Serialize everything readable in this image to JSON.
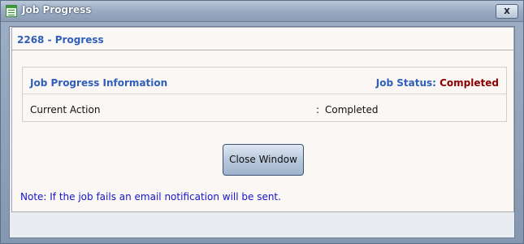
{
  "window": {
    "title": "Job Progress",
    "close_label": "x"
  },
  "panel": {
    "title": "2268 - Progress"
  },
  "info": {
    "title": "Job Progress Information",
    "status_label": "Job Status:",
    "status_value": "Completed",
    "row_label": "Current Action",
    "row_colon": ":",
    "row_value": "Completed"
  },
  "actions": {
    "close_window_label": "Close Window"
  },
  "note": "Note: If the job fails an email notification will be sent.",
  "colors": {
    "accent_blue": "#2f5fb8",
    "status_red": "#8b0000",
    "note_blue": "#1515cc"
  }
}
